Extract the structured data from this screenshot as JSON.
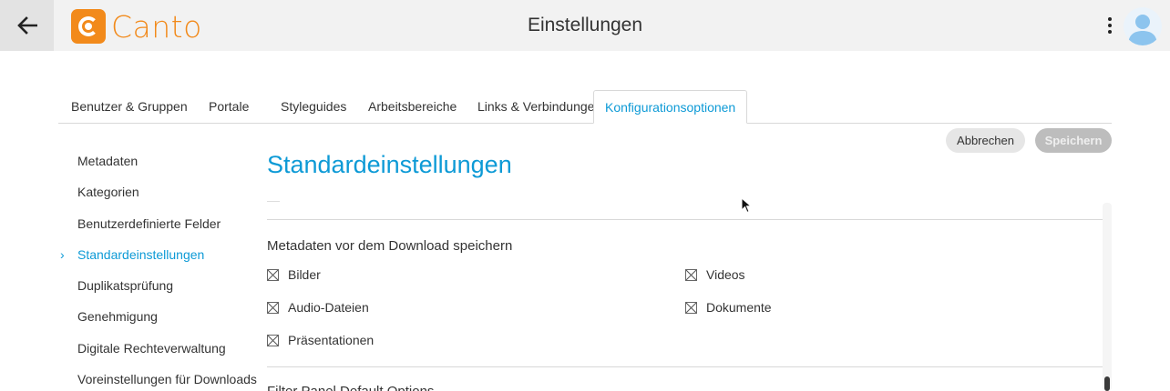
{
  "header": {
    "logo_text": "Canto",
    "title": "Einstellungen",
    "back_icon": "arrow-left-icon",
    "menu_icon": "kebab-menu-icon",
    "avatar_icon": "user-avatar-icon",
    "brand_color": "#f28a1b",
    "accent_color": "#0d9ad6"
  },
  "tabs": [
    {
      "label": "Benutzer & Gruppen",
      "active": false
    },
    {
      "label": "Portale",
      "active": false
    },
    {
      "label": "Styleguides",
      "active": false
    },
    {
      "label": "Arbeitsbereiche",
      "active": false
    },
    {
      "label": "Links & Verbindungen",
      "active": false
    },
    {
      "label": "Konfigurationsoptionen",
      "active": true
    }
  ],
  "sidebar": {
    "items": [
      {
        "label": "Metadaten",
        "active": false
      },
      {
        "label": "Kategorien",
        "active": false
      },
      {
        "label": "Benutzerdefinierte Felder",
        "active": false
      },
      {
        "label": "Standardeinstellungen",
        "active": true
      },
      {
        "label": "Duplikatsprüfung",
        "active": false
      },
      {
        "label": "Genehmigung",
        "active": false
      },
      {
        "label": "Digitale Rechteverwaltung",
        "active": false
      },
      {
        "label": "Voreinstellungen für Downloads",
        "active": false
      }
    ]
  },
  "actions": {
    "cancel_label": "Abbrechen",
    "save_label": "Speichern"
  },
  "main": {
    "title": "Standardeinstellungen",
    "section": {
      "title": "Metadaten vor dem Download speichern",
      "options": [
        {
          "label": "Bilder",
          "checked": true
        },
        {
          "label": "Videos",
          "checked": true
        },
        {
          "label": "Audio-Dateien",
          "checked": true
        },
        {
          "label": "Dokumente",
          "checked": true
        },
        {
          "label": "Präsentationen",
          "checked": true
        }
      ]
    },
    "next_section_title": "Filter Panel Default Options"
  }
}
